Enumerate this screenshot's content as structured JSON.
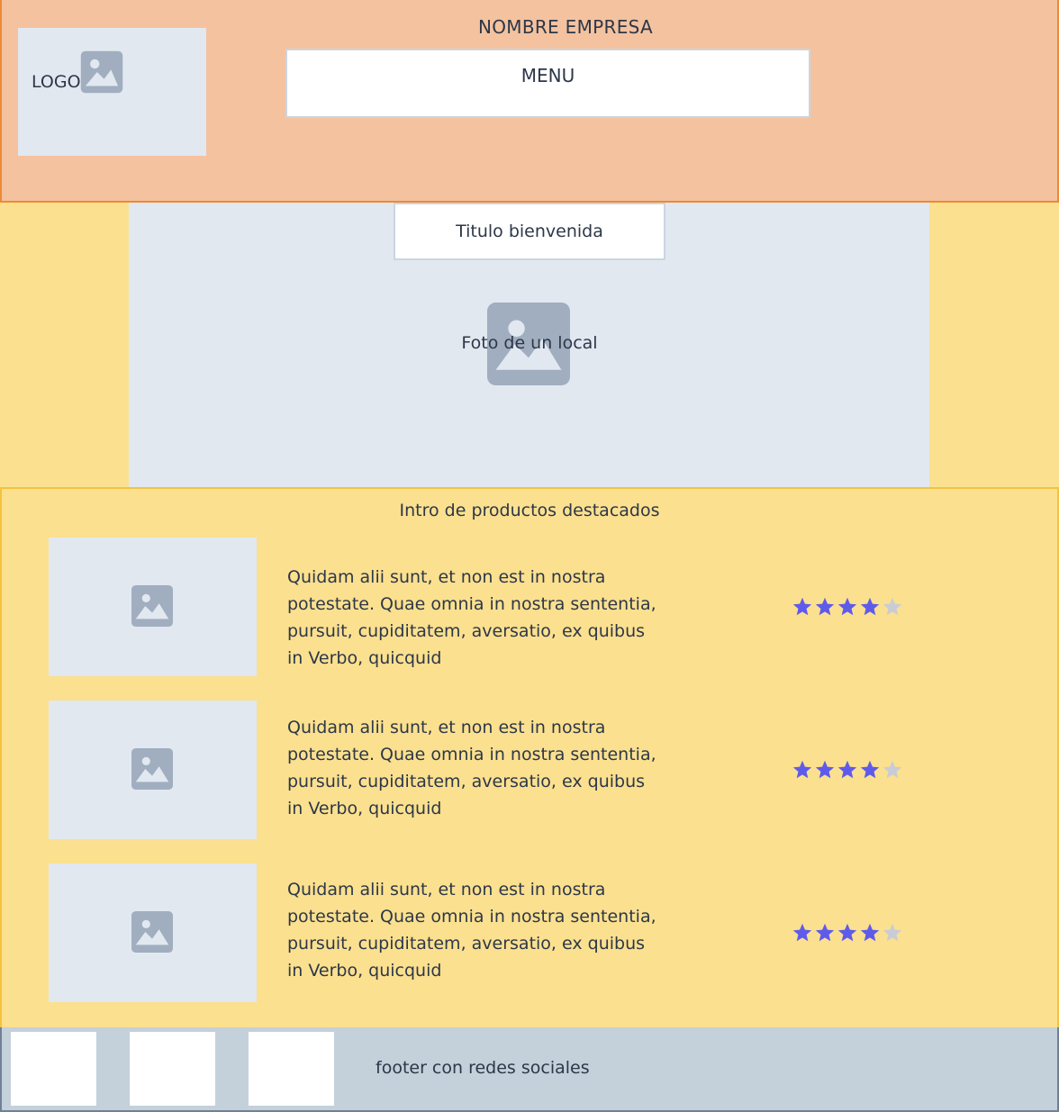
{
  "header": {
    "company_name": "NOMBRE EMPRESA",
    "logo_label": "LOGO",
    "menu_label": "MENU"
  },
  "hero": {
    "welcome_title": "Titulo bienvenida",
    "photo_label": "Foto de un local"
  },
  "products": {
    "intro_title": "Intro de productos destacados",
    "items": [
      {
        "description": "Quidam alii sunt, et non est in nostra potestate. Quae omnia in nostra sententia, pursuit, cupiditatem, aversatio, ex quibus in Verbo, quicquid",
        "rating": 4,
        "max_rating": 5
      },
      {
        "description": "Quidam alii sunt, et non est in nostra potestate. Quae omnia in nostra sententia, pursuit, cupiditatem, aversatio, ex quibus in Verbo, quicquid",
        "rating": 4,
        "max_rating": 5
      },
      {
        "description": "Quidam alii sunt, et non est in nostra potestate. Quae omnia in nostra sententia, pursuit, cupiditatem, aversatio, ex quibus in Verbo, quicquid",
        "rating": 4,
        "max_rating": 5
      }
    ]
  },
  "footer": {
    "text": "footer con redes sociales"
  },
  "colors": {
    "star_filled": "#5f5bea",
    "star_empty": "#c9ccd4",
    "image_icon": "#a0aec0"
  },
  "icons": {
    "image_placeholder": "image-icon",
    "rating": "star-icon"
  }
}
